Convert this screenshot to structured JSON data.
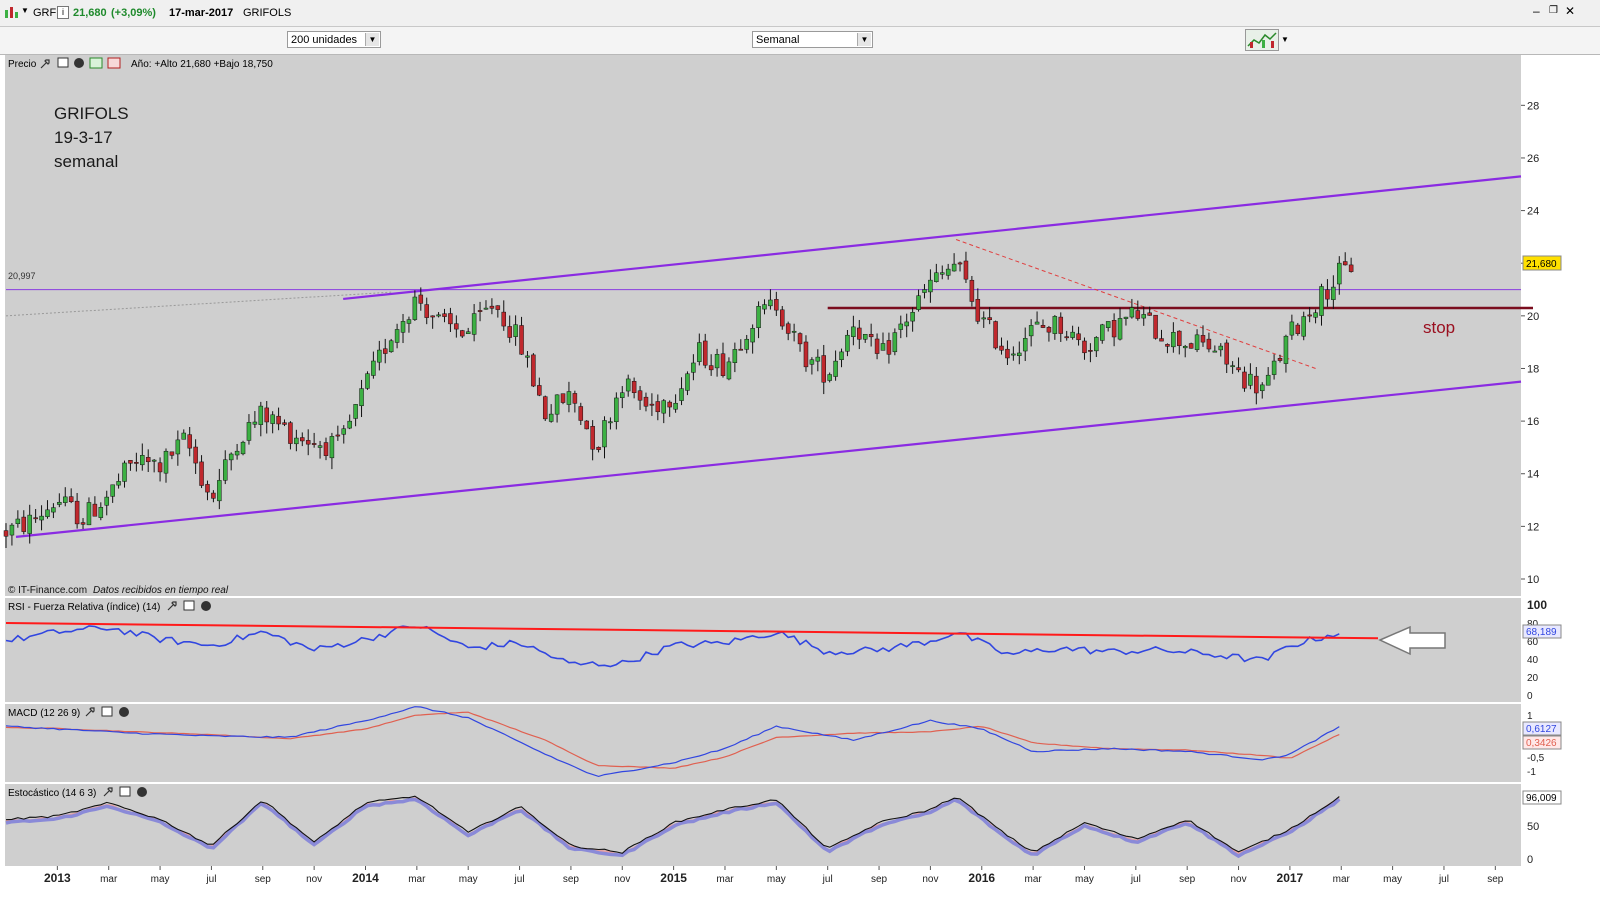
{
  "window": {
    "ticker": "GRF",
    "price": "21,680",
    "change": "(+3,09%)",
    "date": "17-mar-2017",
    "name": "GRIFOLS",
    "info_icon": "i"
  },
  "toolbar": {
    "units": "200 unidades",
    "period": "Semanal"
  },
  "panels": {
    "price": {
      "label": "Precio",
      "stats": "Año: +Alto 21,680 +Bajo 18,750",
      "annotation_lines": [
        "GRIFOLS",
        "19-3-17",
        "semanal"
      ],
      "stop_label": "stop",
      "ref_label": "20,997",
      "last_price": "21,680",
      "copyright": "© IT-Finance.com",
      "realtime": "Datos recibidos en tiempo real"
    },
    "rsi": {
      "label": "RSI - Fuerza Relativa (índice) (14)",
      "last": "68,189"
    },
    "macd": {
      "label": "MACD (12 26 9)",
      "last_macd": "0,6127",
      "last_signal": "0,3426"
    },
    "stoch": {
      "label": "Estocástico (14 6 3)",
      "last": "96,009"
    }
  },
  "colors": {
    "panel_bg": "#cfcfcf",
    "bull": "#3cb043",
    "bear": "#c0282d",
    "channel": "#8a2be2",
    "stop_line": "#7a0d1e",
    "rsi_line": "#3146e0",
    "rsi_trend": "#ff1a1a",
    "macd_line": "#3146e0",
    "macd_signal": "#e06050"
  },
  "chart_data": {
    "type": "candlestick",
    "title": "GRIFOLS",
    "xlabel": "",
    "ylabel": "",
    "ylim": [
      10,
      29
    ],
    "y_ticks": [
      10,
      12,
      14,
      16,
      18,
      20,
      22,
      24,
      26,
      28
    ],
    "x_ticks": [
      {
        "d": "2013-01",
        "label": "2013",
        "bold": true
      },
      {
        "d": "2013-03",
        "label": "mar"
      },
      {
        "d": "2013-05",
        "label": "may"
      },
      {
        "d": "2013-07",
        "label": "jul"
      },
      {
        "d": "2013-09",
        "label": "sep"
      },
      {
        "d": "2013-11",
        "label": "nov"
      },
      {
        "d": "2014-01",
        "label": "2014",
        "bold": true
      },
      {
        "d": "2014-03",
        "label": "mar"
      },
      {
        "d": "2014-05",
        "label": "may"
      },
      {
        "d": "2014-07",
        "label": "jul"
      },
      {
        "d": "2014-09",
        "label": "sep"
      },
      {
        "d": "2014-11",
        "label": "nov"
      },
      {
        "d": "2015-01",
        "label": "2015",
        "bold": true
      },
      {
        "d": "2015-03",
        "label": "mar"
      },
      {
        "d": "2015-05",
        "label": "may"
      },
      {
        "d": "2015-07",
        "label": "jul"
      },
      {
        "d": "2015-09",
        "label": "sep"
      },
      {
        "d": "2015-11",
        "label": "nov"
      },
      {
        "d": "2016-01",
        "label": "2016",
        "bold": true
      },
      {
        "d": "2016-03",
        "label": "mar"
      },
      {
        "d": "2016-05",
        "label": "may"
      },
      {
        "d": "2016-07",
        "label": "jul"
      },
      {
        "d": "2016-09",
        "label": "sep"
      },
      {
        "d": "2016-11",
        "label": "nov"
      },
      {
        "d": "2017-01",
        "label": "2017",
        "bold": true
      },
      {
        "d": "2017-03",
        "label": "mar"
      },
      {
        "d": "2017-05",
        "label": "may"
      },
      {
        "d": "2017-07",
        "label": "jul"
      },
      {
        "d": "2017-09",
        "label": "sep"
      }
    ],
    "x_start": "2012-11",
    "x_end": "2017-10",
    "close_path": [
      [
        "2012-11",
        11.8
      ],
      [
        "2012-12",
        12.2
      ],
      [
        "2013-01",
        13.0
      ],
      [
        "2013-02",
        12.3
      ],
      [
        "2013-03",
        13.2
      ],
      [
        "2013-04",
        14.5
      ],
      [
        "2013-05",
        14.3
      ],
      [
        "2013-06",
        15.3
      ],
      [
        "2013-07",
        13.0
      ],
      [
        "2013-08",
        15.3
      ],
      [
        "2013-09",
        16.3
      ],
      [
        "2013-10",
        15.6
      ],
      [
        "2013-11",
        15.2
      ],
      [
        "2013-12",
        15.0
      ],
      [
        "2014-01",
        17.3
      ],
      [
        "2014-02",
        19.3
      ],
      [
        "2014-03",
        20.7
      ],
      [
        "2014-04",
        19.6
      ],
      [
        "2014-05",
        19.4
      ],
      [
        "2014-06",
        20.5
      ],
      [
        "2014-07",
        19.0
      ],
      [
        "2014-08",
        16.3
      ],
      [
        "2014-09",
        17.0
      ],
      [
        "2014-10",
        15.0
      ],
      [
        "2014-11",
        17.5
      ],
      [
        "2014-12",
        16.5
      ],
      [
        "2015-01",
        17.0
      ],
      [
        "2015-02",
        18.6
      ],
      [
        "2015-03",
        18.1
      ],
      [
        "2015-04",
        19.8
      ],
      [
        "2015-05",
        20.5
      ],
      [
        "2015-06",
        18.5
      ],
      [
        "2015-07",
        17.8
      ],
      [
        "2015-08",
        19.8
      ],
      [
        "2015-09",
        18.3
      ],
      [
        "2015-10",
        19.8
      ],
      [
        "2015-11",
        21.2
      ],
      [
        "2015-12",
        22.0
      ],
      [
        "2016-01",
        19.8
      ],
      [
        "2016-02",
        18.6
      ],
      [
        "2016-03",
        19.5
      ],
      [
        "2016-04",
        19.7
      ],
      [
        "2016-05",
        18.8
      ],
      [
        "2016-06",
        19.5
      ],
      [
        "2016-07",
        20.1
      ],
      [
        "2016-08",
        19.3
      ],
      [
        "2016-09",
        19.0
      ],
      [
        "2016-10",
        18.8
      ],
      [
        "2016-11",
        17.8
      ],
      [
        "2016-12",
        17.2
      ],
      [
        "2017-01",
        19.3
      ],
      [
        "2017-02",
        20.5
      ],
      [
        "2017-03",
        21.68
      ]
    ],
    "last_date": "2017-03-17",
    "last_close": 21.68,
    "channel_upper": [
      [
        "2014-02",
        20.7
      ],
      [
        "2017-10",
        25.3
      ]
    ],
    "channel_lower": [
      [
        "2012-11",
        11.6
      ],
      [
        "2017-10",
        17.5
      ]
    ],
    "resistance_line": {
      "y": 20.997,
      "label": "20,997"
    },
    "stop_line": {
      "y": 20.3,
      "from": "2015-07"
    },
    "dotted_trend": [
      [
        "2012-11",
        20.0
      ],
      [
        "2014-02",
        20.9
      ]
    ],
    "dashed_trend": [
      [
        "2015-12",
        22.9
      ],
      [
        "2017-02",
        18.0
      ]
    ],
    "rsi": {
      "ylim": [
        0,
        100
      ],
      "y_ticks": [
        0,
        20,
        40,
        60,
        80,
        100
      ],
      "last": 68.189,
      "path": [
        [
          "2012-11",
          60
        ],
        [
          "2013-01",
          70
        ],
        [
          "2013-03",
          75
        ],
        [
          "2013-05",
          62
        ],
        [
          "2013-07",
          55
        ],
        [
          "2013-09",
          70
        ],
        [
          "2013-11",
          50
        ],
        [
          "2014-01",
          62
        ],
        [
          "2014-03",
          78
        ],
        [
          "2014-05",
          52
        ],
        [
          "2014-07",
          58
        ],
        [
          "2014-09",
          34
        ],
        [
          "2014-11",
          35
        ],
        [
          "2015-01",
          55
        ],
        [
          "2015-03",
          58
        ],
        [
          "2015-05",
          70
        ],
        [
          "2015-07",
          48
        ],
        [
          "2015-09",
          50
        ],
        [
          "2015-11",
          60
        ],
        [
          "2015-12",
          70
        ],
        [
          "2016-02",
          45
        ],
        [
          "2016-04",
          52
        ],
        [
          "2016-06",
          48
        ],
        [
          "2016-08",
          50
        ],
        [
          "2016-10",
          45
        ],
        [
          "2016-12",
          38
        ],
        [
          "2017-01",
          55
        ],
        [
          "2017-03",
          70
        ]
      ],
      "trendline": [
        [
          "2012-11",
          80
        ],
        [
          "2017-03",
          63
        ]
      ]
    },
    "macd": {
      "ylim": [
        -1.5,
        1.5
      ],
      "y_ticks": [
        1,
        0.5,
        0,
        -0.5,
        -1
      ],
      "macd": [
        [
          "2012-11",
          0.6
        ],
        [
          "2013-01",
          0.5
        ],
        [
          "2013-04",
          0.35
        ],
        [
          "2013-07",
          0.25
        ],
        [
          "2013-10",
          0.2
        ],
        [
          "2014-01",
          0.8
        ],
        [
          "2014-03",
          1.3
        ],
        [
          "2014-05",
          0.9
        ],
        [
          "2014-08",
          -0.4
        ],
        [
          "2014-10",
          -1.2
        ],
        [
          "2015-01",
          -0.7
        ],
        [
          "2015-03",
          -0.2
        ],
        [
          "2015-05",
          0.6
        ],
        [
          "2015-08",
          0.1
        ],
        [
          "2015-11",
          0.8
        ],
        [
          "2016-01",
          0.5
        ],
        [
          "2016-03",
          -0.3
        ],
        [
          "2016-06",
          -0.2
        ],
        [
          "2016-09",
          -0.3
        ],
        [
          "2016-12",
          -0.6
        ],
        [
          "2017-01",
          -0.4
        ],
        [
          "2017-03",
          0.6127
        ]
      ],
      "signal": [
        [
          "2012-11",
          0.55
        ],
        [
          "2013-01",
          0.52
        ],
        [
          "2013-04",
          0.4
        ],
        [
          "2013-07",
          0.3
        ],
        [
          "2013-10",
          0.15
        ],
        [
          "2014-01",
          0.5
        ],
        [
          "2014-03",
          1.0
        ],
        [
          "2014-05",
          1.1
        ],
        [
          "2014-08",
          0.1
        ],
        [
          "2014-10",
          -0.8
        ],
        [
          "2015-01",
          -0.9
        ],
        [
          "2015-03",
          -0.5
        ],
        [
          "2015-05",
          0.2
        ],
        [
          "2015-08",
          0.35
        ],
        [
          "2015-11",
          0.4
        ],
        [
          "2016-01",
          0.6
        ],
        [
          "2016-03",
          0.0
        ],
        [
          "2016-06",
          -0.2
        ],
        [
          "2016-09",
          -0.25
        ],
        [
          "2016-12",
          -0.45
        ],
        [
          "2017-01",
          -0.55
        ],
        [
          "2017-03",
          0.3426
        ]
      ]
    },
    "stochastic": {
      "ylim": [
        0,
        100
      ],
      "y_ticks": [
        0,
        50
      ],
      "last": 96.009,
      "path": [
        [
          "2012-11",
          60
        ],
        [
          "2013-01",
          65
        ],
        [
          "2013-03",
          85
        ],
        [
          "2013-05",
          60
        ],
        [
          "2013-07",
          20
        ],
        [
          "2013-09",
          90
        ],
        [
          "2013-11",
          25
        ],
        [
          "2014-01",
          85
        ],
        [
          "2014-03",
          95
        ],
        [
          "2014-05",
          40
        ],
        [
          "2014-07",
          80
        ],
        [
          "2014-09",
          20
        ],
        [
          "2014-11",
          10
        ],
        [
          "2015-01",
          55
        ],
        [
          "2015-03",
          75
        ],
        [
          "2015-05",
          90
        ],
        [
          "2015-07",
          15
        ],
        [
          "2015-09",
          55
        ],
        [
          "2015-11",
          75
        ],
        [
          "2015-12",
          95
        ],
        [
          "2016-02",
          35
        ],
        [
          "2016-03",
          10
        ],
        [
          "2016-05",
          55
        ],
        [
          "2016-07",
          30
        ],
        [
          "2016-09",
          60
        ],
        [
          "2016-11",
          10
        ],
        [
          "2017-01",
          45
        ],
        [
          "2017-03",
          96
        ]
      ]
    }
  }
}
